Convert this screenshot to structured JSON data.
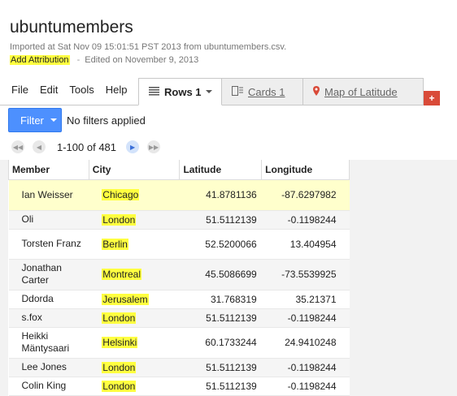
{
  "app": {
    "title": "ubuntumembers",
    "import_meta": "Imported at Sat Nov 09 15:01:51 PST 2013 from ubuntumembers.csv.",
    "attribution_link": "Add Attribution",
    "separator": "-",
    "edited": "Edited on November 9, 2013"
  },
  "menu": [
    "File",
    "Edit",
    "Tools",
    "Help"
  ],
  "tabs": {
    "rows": "Rows 1",
    "cards": "Cards 1",
    "map": "Map of Latitude",
    "add": "+"
  },
  "filter": {
    "button_label": "Filter",
    "status": "No filters applied"
  },
  "pager": {
    "range": "1-100 of 481"
  },
  "table": {
    "columns": [
      "Member",
      "City",
      "Latitude",
      "Longitude"
    ],
    "rows": [
      {
        "member": "Ian Weisser",
        "city": "Chicago",
        "lat": "41.8781136",
        "lon": "-87.6297982"
      },
      {
        "member": "Oli",
        "city": "London",
        "lat": "51.5112139",
        "lon": "-0.1198244"
      },
      {
        "member": "Torsten Franz",
        "city": "Berlin",
        "lat": "52.5200066",
        "lon": "13.404954"
      },
      {
        "member": "Jonathan Carter",
        "city": "Montreal",
        "lat": "45.5086699",
        "lon": "-73.5539925"
      },
      {
        "member": "Ddorda",
        "city": "Jerusalem",
        "lat": "31.768319",
        "lon": "35.21371"
      },
      {
        "member": "s.fox",
        "city": "London",
        "lat": "51.5112139",
        "lon": "-0.1198244"
      },
      {
        "member": "Heikki Mäntysaari",
        "city": "Helsinki",
        "lat": "60.1733244",
        "lon": "24.9410248"
      },
      {
        "member": "Lee Jones",
        "city": "London",
        "lat": "51.5112139",
        "lon": "-0.1198244"
      },
      {
        "member": "Colin King",
        "city": "London",
        "lat": "51.5112139",
        "lon": "-0.1198244"
      }
    ]
  },
  "colors": {
    "accent": "#4d90fe",
    "highlight": "#ffff40",
    "selected_row": "#ffffcc",
    "add_tab": "#d94a38"
  }
}
